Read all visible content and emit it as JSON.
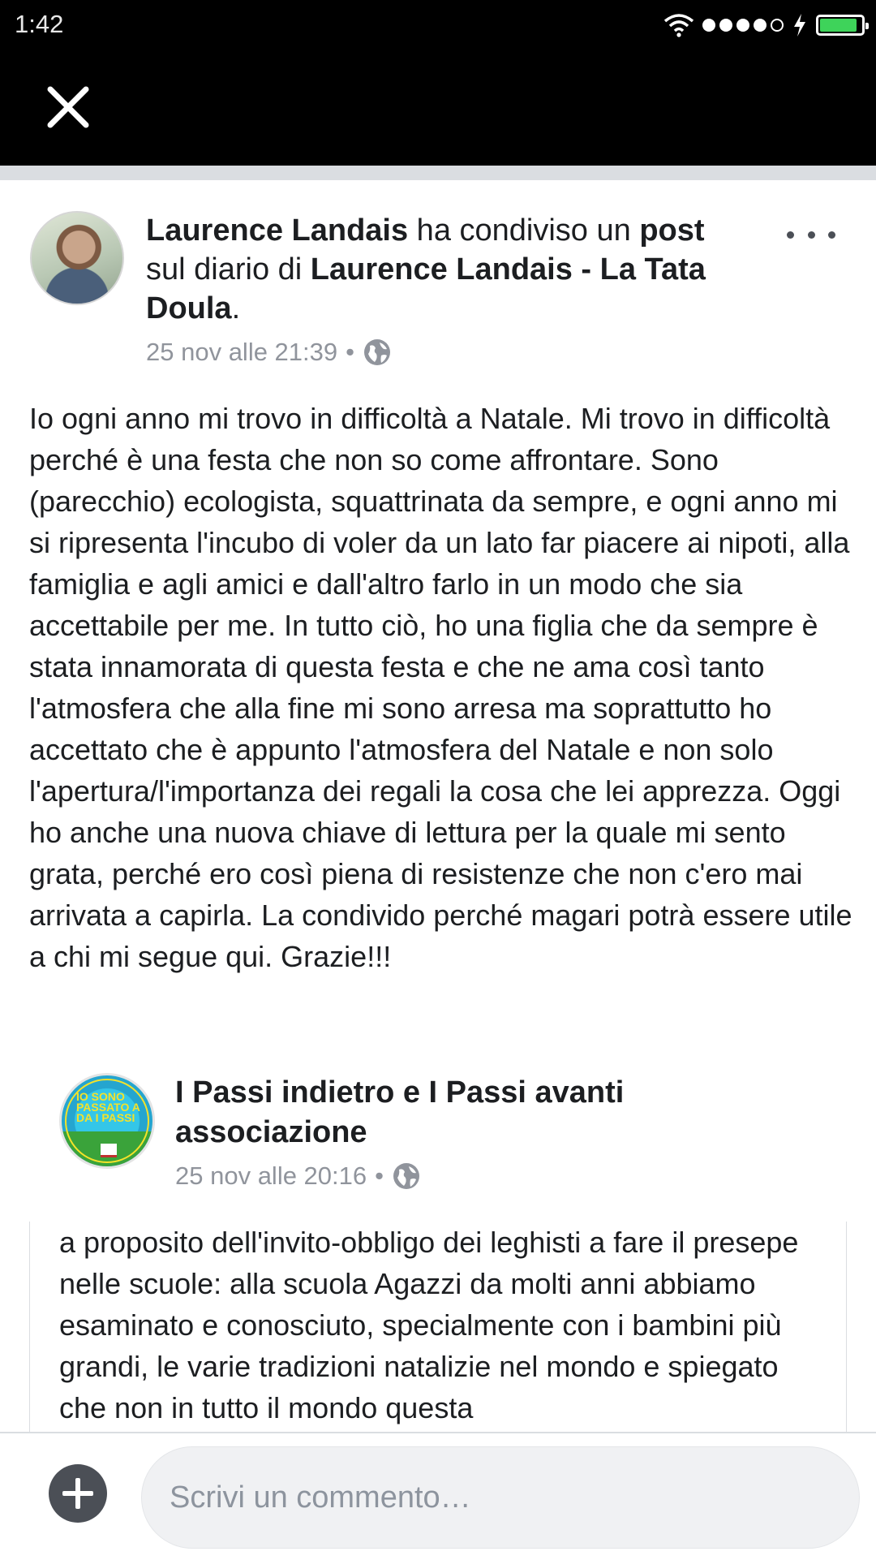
{
  "status_bar": {
    "time": "1:42",
    "battery_level": 0.9,
    "signal_strength": "4 of 5"
  },
  "top_bar": {
    "close_icon": "close-icon"
  },
  "post": {
    "author": "Laurence Landais",
    "action_text": " ha condiviso un ",
    "object_text": "post",
    "target_prefix": " sul diario di ",
    "target_name": "Laurence Landais - La Tata Doula",
    "target_suffix": ".",
    "timestamp": "25 nov alle 21:39",
    "separator": "•",
    "privacy_icon": "globe-icon",
    "more_icon": "more-options-icon",
    "body": "Io ogni anno mi trovo in difficoltà a Natale. Mi trovo in difficoltà perché è una festa che non so come affrontare. Sono (parecchio) ecologista, squattrinata da sempre, e ogni anno mi si ripresenta l'incubo di voler da un lato far piacere ai nipoti, alla famiglia e agli amici e dall'altro farlo in un modo che sia accettabile per me. In tutto ciò, ho una figlia che da sempre è stata innamorata di questa festa e che ne ama così tanto l'atmosfera che alla fine mi sono arresa ma soprattutto ho accettato che è appunto l'atmosfera del Natale e non solo l'apertura/l'importanza dei regali la cosa che lei apprezza. Oggi ho anche una nuova chiave di lettura per la quale mi sento grata, perché ero così piena di resistenze che non c'ero mai arrivata a capirla. La condivido perché magari potrà essere utile a chi mi segue qui. Grazie!!!"
  },
  "shared_post": {
    "page_name": "I Passi indietro e I Passi avanti associazione",
    "avatar_text": "IO SONO PASSATO A DA I PASSI",
    "timestamp": "25 nov alle 20:16",
    "separator": "•",
    "privacy_icon": "globe-icon",
    "body": "a proposito dell'invito-obbligo dei leghisti a fare il presepe nelle scuole: alla scuola Agazzi da molti anni abbiamo esaminato e conosciuto, specialmente con i bambini più grandi, le varie tradizioni natalizie nel mondo e spiegato che non in tutto il mondo questa"
  },
  "comment_bar": {
    "add_icon": "plus-circle-icon",
    "placeholder": "Scrivi un commento…"
  }
}
